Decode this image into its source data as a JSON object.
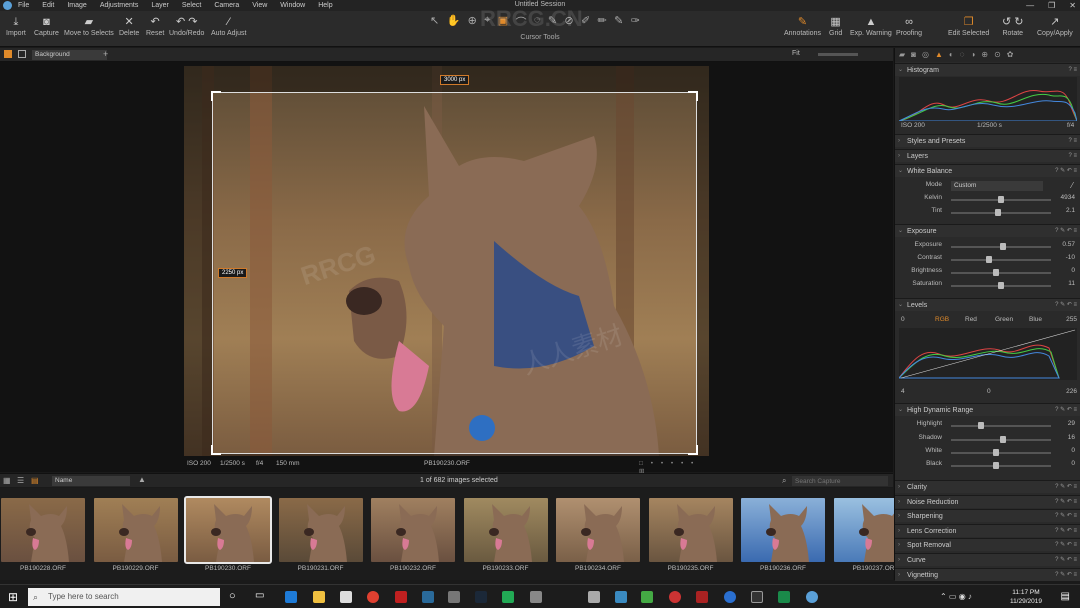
{
  "window": {
    "title": "Untitled Session",
    "controls": [
      "—",
      "❐",
      "✕"
    ]
  },
  "menu": [
    "File",
    "Edit",
    "Image",
    "Adjustments",
    "Layer",
    "Select",
    "Camera",
    "View",
    "Window",
    "Help"
  ],
  "toolbar": {
    "left": [
      {
        "label": "Import",
        "icon": "import-icon",
        "glyph": "⤓"
      },
      {
        "label": "Capture",
        "icon": "camera-icon",
        "glyph": "◙"
      },
      {
        "label": "Move to Selects",
        "icon": "folder-icon",
        "glyph": "▰"
      },
      {
        "label": "Delete",
        "icon": "delete-icon",
        "glyph": "✕"
      },
      {
        "label": "Reset",
        "icon": "reset-icon",
        "glyph": "↶"
      },
      {
        "label": "Undo/Redo",
        "icon": "undo-icon",
        "glyph": "↶ ↷"
      },
      {
        "label": "Auto Adjust",
        "icon": "wand-icon",
        "glyph": "⁄"
      }
    ],
    "cursor_tools_label": "Cursor Tools",
    "cursor_tools": [
      "↖",
      "✋",
      "⊕",
      "⌖",
      "▣",
      "⌒",
      "◌",
      "✎",
      "⊘",
      "✐",
      "✏",
      "✎",
      "✑"
    ],
    "right": [
      {
        "label": "Annotations",
        "icon": "annotations-icon",
        "glyph": "✎"
      },
      {
        "label": "Grid",
        "icon": "grid-icon",
        "glyph": "▦"
      },
      {
        "label": "Exp. Warning",
        "icon": "warning-icon",
        "glyph": "▲"
      },
      {
        "label": "Proofing",
        "icon": "proofing-icon",
        "glyph": "∞"
      },
      {
        "label": "Edit Selected",
        "icon": "edit-selected-icon",
        "glyph": "❐"
      },
      {
        "label": "Rotate",
        "icon": "rotate-icon",
        "glyph": "↺ ↻"
      },
      {
        "label": "Copy/Apply",
        "icon": "copy-apply-icon",
        "glyph": "↗"
      }
    ]
  },
  "viewer": {
    "background_select": "Background",
    "fit_label": "Fit",
    "width_px": "3000 px",
    "height_px": "2250 px",
    "iso": "ISO 200",
    "shutter": "1/2500 s",
    "aperture": "f/4",
    "focal": "150 mm",
    "filename": "PB190230.ORF"
  },
  "browser": {
    "sort": "Name",
    "count": "1 of 682 images selected",
    "search_placeholder": "Search Capture",
    "thumbs": [
      "PB190228.ORF",
      "PB190229.ORF",
      "PB190230.ORF",
      "PB190231.ORF",
      "PB190232.ORF",
      "PB190233.ORF",
      "PB190234.ORF",
      "PB190235.ORF",
      "PB190236.ORF",
      "PB190237.ORF"
    ],
    "selected_index": 2
  },
  "panels": {
    "histogram": {
      "title": "Histogram",
      "iso": "ISO 200",
      "shutter": "1/2500 s",
      "aperture": "f/4"
    },
    "styles": "Styles and Presets",
    "layers": "Layers",
    "white_balance": {
      "title": "White Balance",
      "mode_label": "Mode",
      "mode_value": "Custom",
      "sliders": [
        {
          "label": "Kelvin",
          "value": "4934",
          "pos": 0.5
        },
        {
          "label": "Tint",
          "value": "2.1",
          "pos": 0.47
        }
      ]
    },
    "exposure": {
      "title": "Exposure",
      "sliders": [
        {
          "label": "Exposure",
          "value": "0.57",
          "pos": 0.52
        },
        {
          "label": "Contrast",
          "value": "-10",
          "pos": 0.38
        },
        {
          "label": "Brightness",
          "value": "0",
          "pos": 0.45
        },
        {
          "label": "Saturation",
          "value": "11",
          "pos": 0.5
        }
      ]
    },
    "levels": {
      "title": "Levels",
      "min": "0",
      "max": "255",
      "channels": [
        "RGB",
        "Red",
        "Green",
        "Blue"
      ],
      "out_low": "4",
      "mid": "0",
      "out_high": "226"
    },
    "hdr": {
      "title": "High Dynamic Range",
      "sliders": [
        {
          "label": "Highlight",
          "value": "29",
          "pos": 0.3
        },
        {
          "label": "Shadow",
          "value": "16",
          "pos": 0.52
        },
        {
          "label": "White",
          "value": "0",
          "pos": 0.45
        },
        {
          "label": "Black",
          "value": "0",
          "pos": 0.45
        }
      ]
    },
    "collapsed": [
      "Clarity",
      "Noise Reduction",
      "Sharpening",
      "Lens Correction",
      "Spot Removal",
      "Curve",
      "Vignetting"
    ]
  },
  "taskbar": {
    "search_placeholder": "Type here to search",
    "time": "11:17 PM",
    "date": "11/29/2019"
  },
  "watermarks": [
    "RRCG",
    "人人素材",
    "RRCG.CN"
  ],
  "colors": {
    "accent": "#e08a2a",
    "panel": "#2a2a2a",
    "toolbar": "#2b2b2b"
  }
}
